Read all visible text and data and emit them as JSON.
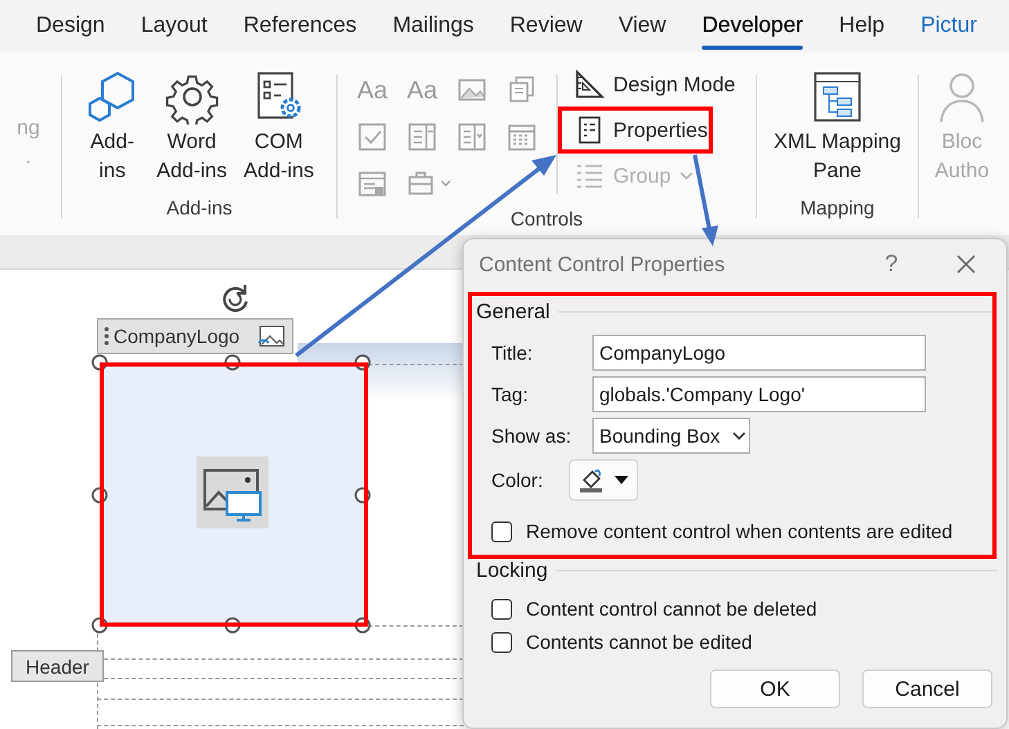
{
  "ribbon_tabs": [
    {
      "label": "Design",
      "selected": false,
      "kind": "normal"
    },
    {
      "label": "Layout",
      "selected": false,
      "kind": "normal"
    },
    {
      "label": "References",
      "selected": false,
      "kind": "normal"
    },
    {
      "label": "Mailings",
      "selected": false,
      "kind": "normal"
    },
    {
      "label": "Review",
      "selected": false,
      "kind": "normal"
    },
    {
      "label": "View",
      "selected": false,
      "kind": "normal"
    },
    {
      "label": "Developer",
      "selected": true,
      "kind": "normal"
    },
    {
      "label": "Help",
      "selected": false,
      "kind": "normal"
    },
    {
      "label": "Pictur",
      "selected": false,
      "kind": "contextual"
    }
  ],
  "ribbon_groups": [
    {
      "kind": "cut",
      "buttons": [
        {
          "lines": [
            "ng",
            "."
          ],
          "disabled": true
        }
      ]
    },
    {
      "kind": "large",
      "label": "Add-ins",
      "buttons": [
        {
          "lines": [
            "Add-",
            "ins"
          ],
          "disabled": false
        },
        {
          "lines": [
            "Word",
            "Add-ins"
          ],
          "disabled": false
        },
        {
          "lines": [
            "COM",
            "Add-ins"
          ],
          "disabled": false
        }
      ]
    },
    {
      "kind": "controls",
      "label": "Controls",
      "gallery": [
        {
          "kind": "text",
          "label": "Aa"
        },
        {
          "kind": "text",
          "label": "Aa"
        },
        {
          "kind": "image"
        },
        {
          "kind": "blocks"
        },
        {
          "kind": "checkbox"
        },
        {
          "kind": "combo"
        },
        {
          "kind": "list"
        },
        {
          "kind": "calendar"
        },
        {
          "kind": "legacy"
        },
        {
          "kind": "tools"
        }
      ],
      "buttons": [
        {
          "label": "Design Mode",
          "disabled": false
        },
        {
          "label": "Properties",
          "disabled": false
        },
        {
          "label": "Group",
          "disabled": true
        }
      ]
    },
    {
      "kind": "large",
      "label": "Mapping",
      "buttons": [
        {
          "lines": [
            "XML Mapping",
            "Pane"
          ],
          "disabled": false
        }
      ]
    },
    {
      "kind": "large",
      "buttons": [
        {
          "lines": [
            "Bloc",
            "Autho"
          ],
          "disabled": true
        }
      ]
    }
  ],
  "document": {
    "content_control_title": "CompanyLogo",
    "header_tag": "Header"
  },
  "dialog": {
    "title": "Content Control Properties",
    "help": "?",
    "general_label": "General",
    "title_field": {
      "label": "Title:",
      "value": "CompanyLogo"
    },
    "tag_field": {
      "label": "Tag:",
      "value": "globals.'Company Logo'"
    },
    "show_as": {
      "label": "Show as:",
      "value": "Bounding Box"
    },
    "color": {
      "label": "Color:"
    },
    "remove_checkbox": {
      "label": "Remove content control when contents are edited",
      "checked": false
    },
    "locking_label": "Locking",
    "locking_checkboxes": [
      {
        "label": "Content control cannot be deleted",
        "checked": false
      },
      {
        "label": "Contents cannot be edited",
        "checked": false
      }
    ],
    "buttons": [
      "OK",
      "Cancel"
    ]
  }
}
